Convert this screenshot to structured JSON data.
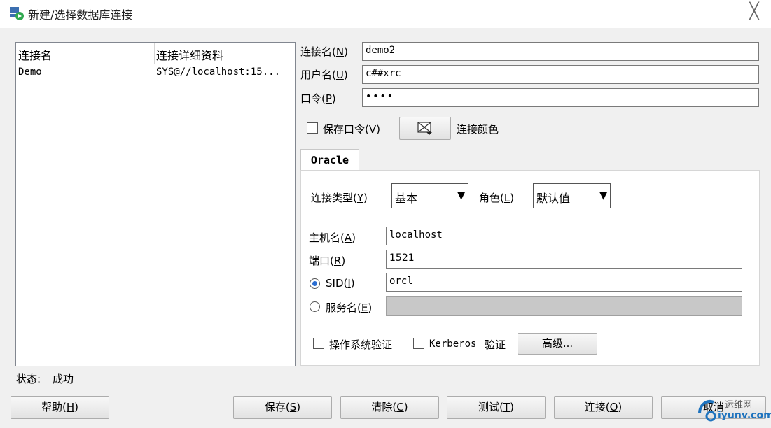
{
  "window": {
    "title": "新建/选择数据库连接",
    "icon": "database-connect-icon",
    "close_icon": "close-icon",
    "close_glyph": "╳"
  },
  "connections": {
    "headers": [
      "连接名",
      "连接详细资料"
    ],
    "rows": [
      {
        "name": "Demo",
        "detail": "SYS@//localhost:15..."
      }
    ]
  },
  "form": {
    "conn_name": {
      "label": "连接名",
      "key": "N",
      "value": "demo2"
    },
    "user": {
      "label": "用户名",
      "key": "U",
      "value": "c##xrc"
    },
    "password": {
      "label": "口令",
      "key": "P",
      "value": "••••"
    },
    "save_password": {
      "label": "保存口令",
      "key": "V",
      "checked": false
    },
    "color_label": "连接颜色",
    "color_icon": "color-picker-icon"
  },
  "tab": {
    "label": "Oracle"
  },
  "oracle": {
    "conn_type": {
      "label": "连接类型",
      "key": "Y",
      "value": "基本"
    },
    "role": {
      "label": "角色",
      "key": "L",
      "value": "默认值"
    },
    "host": {
      "label": "主机名",
      "key": "A",
      "value": "localhost"
    },
    "port": {
      "label": "端口",
      "key": "R",
      "value": "1521"
    },
    "sid": {
      "label": "SID",
      "key": "I",
      "value": "orcl",
      "selected": true
    },
    "service": {
      "label": "服务名",
      "key": "E",
      "value": "",
      "selected": false
    },
    "os_auth": {
      "label": "操作系统验证",
      "checked": false
    },
    "kerberos": {
      "label_prefix": "Kerberos",
      "label_suffix": "验证",
      "checked": false
    },
    "advanced_label": "高级..."
  },
  "status": {
    "label": "状态:",
    "value": "成功"
  },
  "buttons": {
    "help": {
      "label": "帮助",
      "key": "H"
    },
    "save": {
      "label": "保存",
      "key": "S"
    },
    "clear": {
      "label": "清除",
      "key": "C"
    },
    "test": {
      "label": "测试",
      "key": "T"
    },
    "connect": {
      "label": "连接",
      "key": "O"
    },
    "cancel": {
      "label": "取消"
    }
  },
  "watermark": {
    "line1": "运维网",
    "line2": "iyunv.com"
  }
}
